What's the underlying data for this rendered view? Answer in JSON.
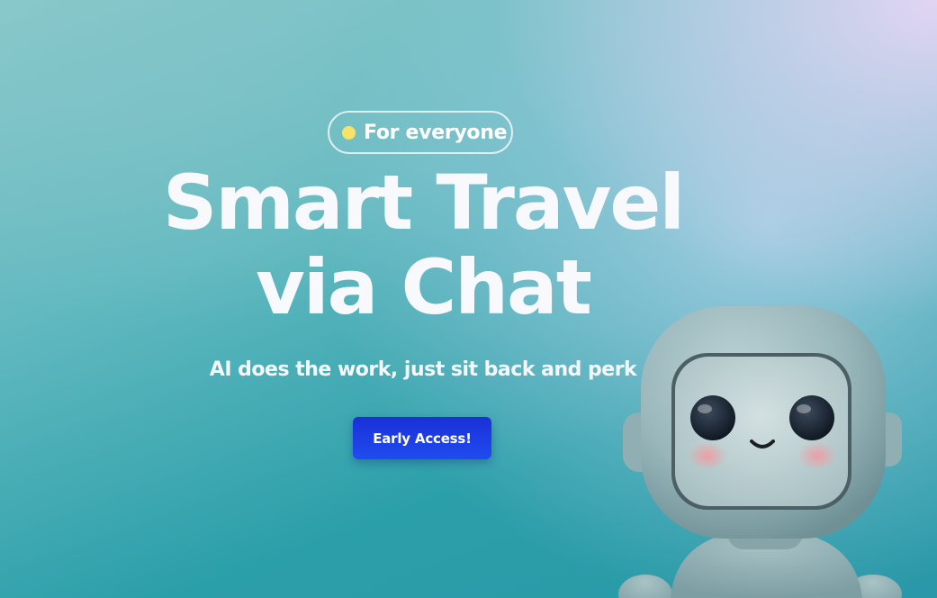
{
  "hero": {
    "badge_label": "For everyone",
    "title_line1": "Smart Travel",
    "title_line2": "via Chat",
    "subtitle": "AI does the work, just sit back and perk",
    "cta_label": "Early Access!"
  },
  "colors": {
    "badge_dot": "#f6e46a",
    "cta_background": "#1e3be6",
    "text": "#ffffff"
  },
  "mascot": {
    "icon": "robot-mascot-icon"
  }
}
